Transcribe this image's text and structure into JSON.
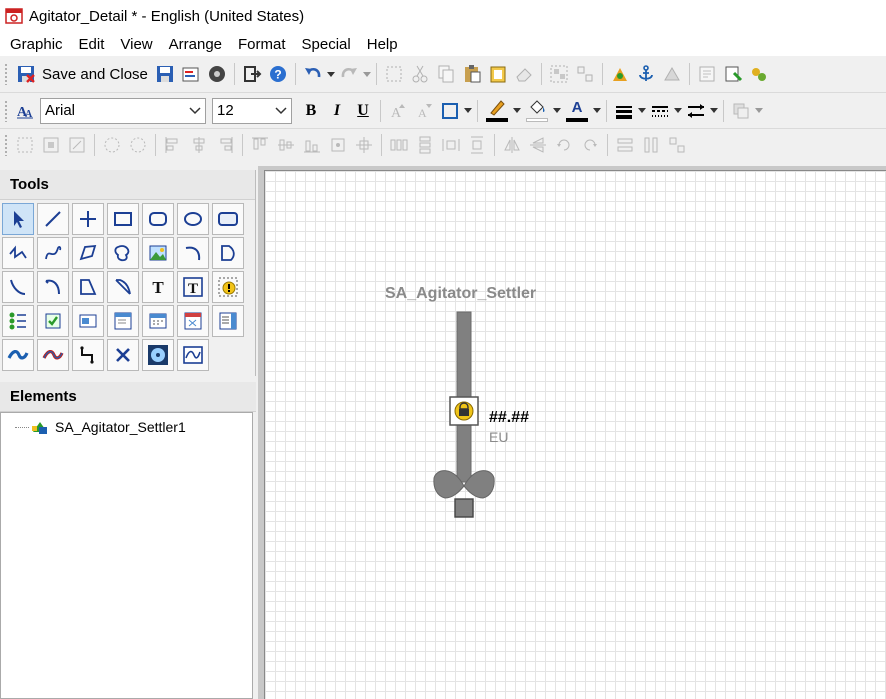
{
  "window": {
    "title": "Agitator_Detail * - English (United States)"
  },
  "menu": [
    "Graphic",
    "Edit",
    "View",
    "Arrange",
    "Format",
    "Special",
    "Help"
  ],
  "toolbar": {
    "save_close_label": "Save and Close"
  },
  "format": {
    "font_name": "Arial",
    "font_size": "12",
    "bold": "B",
    "italic": "I",
    "underline": "U"
  },
  "panels": {
    "tools_title": "Tools",
    "elements_title": "Elements"
  },
  "elements_tree": [
    {
      "label": "SA_Agitator_Settler1",
      "icon": "symbol-icon"
    }
  ],
  "canvas": {
    "symbol_title": "SA_Agitator_Settler",
    "value": "##.##",
    "unit": "EU"
  },
  "colors": {
    "accent": "#1e6fd0",
    "canvas_bg": "#ffffff",
    "grid": "#e4e4e4"
  }
}
